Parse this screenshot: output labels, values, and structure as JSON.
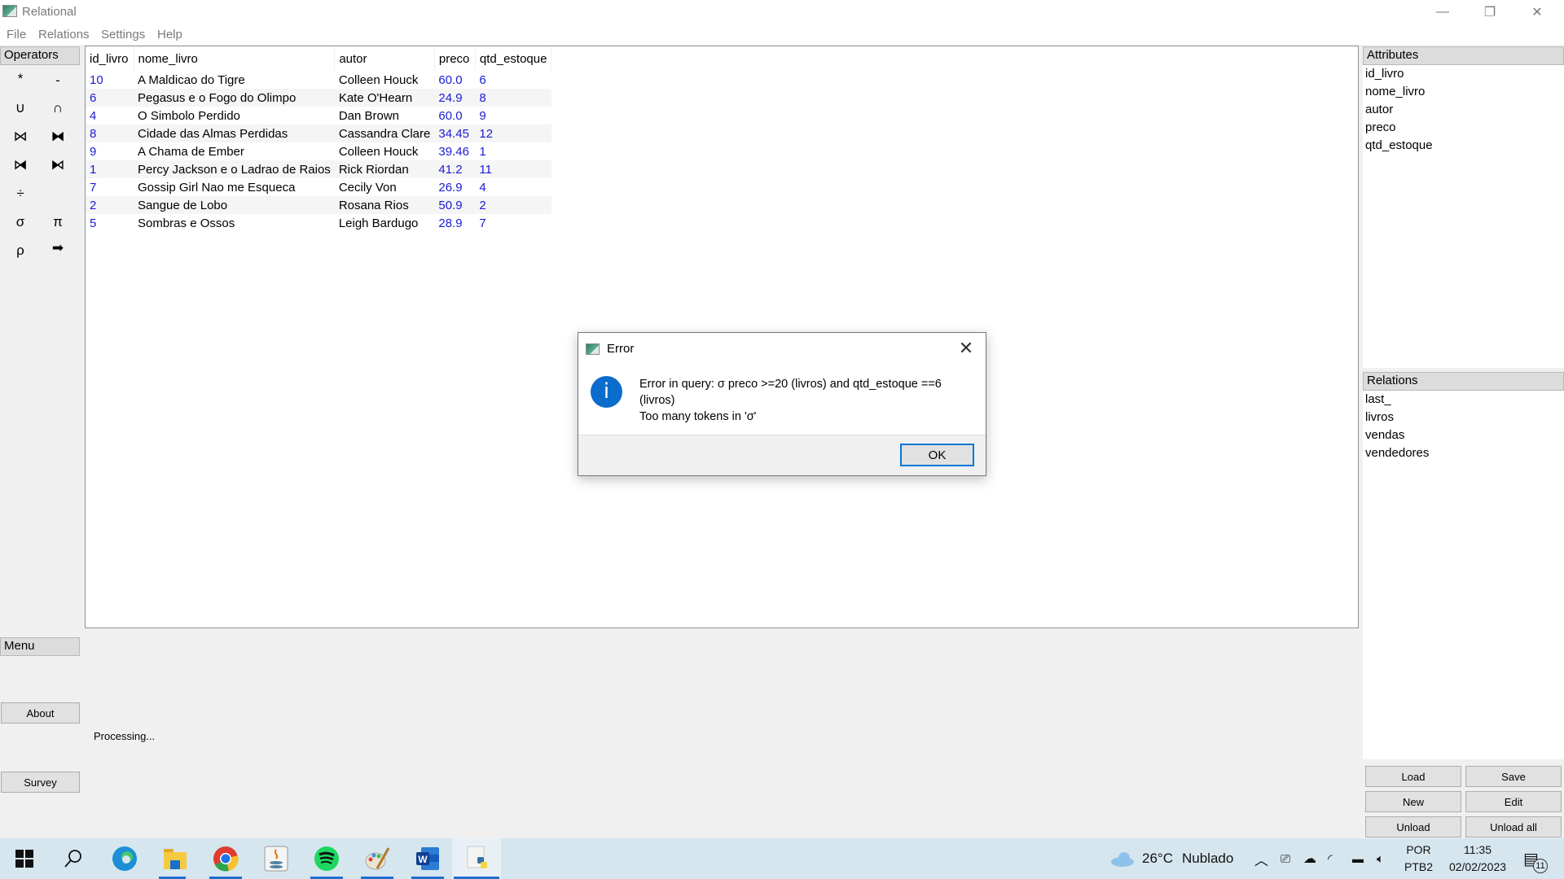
{
  "window": {
    "title": "Relational",
    "controls": {
      "minimize": "—",
      "maximize": "❐",
      "close": "✕"
    }
  },
  "menubar": [
    "File",
    "Relations",
    "Settings",
    "Help"
  ],
  "operators": {
    "header": "Operators",
    "items": [
      {
        "symbol": "*",
        "name": "product"
      },
      {
        "symbol": "-",
        "name": "difference"
      },
      {
        "symbol": "∪",
        "name": "union"
      },
      {
        "symbol": "∩",
        "name": "intersection"
      },
      {
        "symbol": "⋈",
        "name": "natural-join"
      },
      {
        "symbol": "⧓",
        "name": "full-outer-join"
      },
      {
        "symbol": "⧒",
        "name": "left-outer-join"
      },
      {
        "symbol": "⧑",
        "name": "right-outer-join"
      },
      {
        "symbol": "÷",
        "name": "division"
      },
      {
        "symbol": "σ",
        "name": "selection"
      },
      {
        "symbol": "π",
        "name": "projection"
      },
      {
        "symbol": "ρ",
        "name": "rename"
      },
      {
        "symbol": "➡",
        "name": "assign"
      }
    ]
  },
  "table": {
    "columns": [
      "id_livro",
      "nome_livro",
      "autor",
      "preco",
      "qtd_estoque"
    ],
    "rows": [
      [
        "10",
        "A Maldicao do Tigre",
        "Colleen Houck",
        "60.0",
        "6"
      ],
      [
        "6",
        "Pegasus e o Fogo do Olimpo",
        "Kate O'Hearn",
        "24.9",
        "8"
      ],
      [
        "4",
        "O Simbolo Perdido",
        "Dan Brown",
        "60.0",
        "9"
      ],
      [
        "8",
        "Cidade das Almas Perdidas",
        "Cassandra Clare",
        "34.45",
        "12"
      ],
      [
        "9",
        "A Chama de Ember",
        "Colleen Houck",
        "39.46",
        "1"
      ],
      [
        "1",
        "Percy Jackson e o Ladrao de Raios",
        "Rick Riordan",
        "41.2",
        "11"
      ],
      [
        "7",
        "Gossip Girl Nao me Esqueca",
        "Cecily Von",
        "26.9",
        "4"
      ],
      [
        "2",
        "Sangue de Lobo",
        "Rosana Rios",
        "50.9",
        "2"
      ],
      [
        "5",
        "Sombras e Ossos",
        "Leigh Bardugo",
        "28.9",
        "7"
      ]
    ]
  },
  "attributes": {
    "header": "Attributes",
    "items": [
      "id_livro",
      "nome_livro",
      "autor",
      "preco",
      "qtd_estoque"
    ]
  },
  "relations": {
    "header": "Relations",
    "items": [
      "last_",
      "livros",
      "vendas",
      "vendedores"
    ]
  },
  "relation_buttons": {
    "load": "Load",
    "save": "Save",
    "new": "New",
    "edit": "Edit",
    "unload": "Unload",
    "unload_all": "Unload all"
  },
  "menu": {
    "header": "Menu",
    "about": "About",
    "survey": "Survey"
  },
  "status": "Processing...",
  "dialog": {
    "title": "Error",
    "icon": "i",
    "line1": "Error in query: σ preco >=20 (livros) and qtd_estoque ==6",
    "line2": "(livros)",
    "line3": "Too many tokens in 'σ'",
    "ok": "OK"
  },
  "taskbar": {
    "apps": [
      "start",
      "search",
      "edge",
      "file-explorer",
      "chrome",
      "java",
      "spotify",
      "paint",
      "word",
      "python"
    ],
    "weather": {
      "temp": "26°C",
      "condition": "Nublado"
    },
    "language": {
      "lang": "POR",
      "layout": "PTB2"
    },
    "time": "11:35",
    "date": "02/02/2023",
    "notifications": "11"
  },
  "colors": {
    "numeric_text": "#1a1ad6",
    "accent": "#0078d7",
    "taskbar": "#d6e6ee"
  }
}
